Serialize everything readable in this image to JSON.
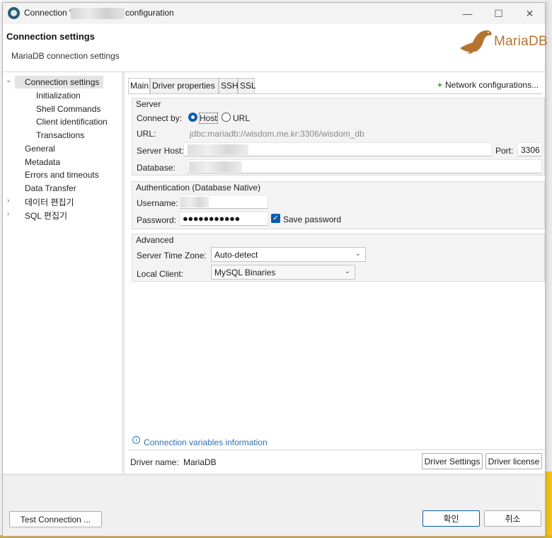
{
  "window": {
    "title_prefix": "Connection \"",
    "title_suffix": "configuration"
  },
  "header": {
    "title": "Connection settings",
    "subtitle": "MariaDB connection settings",
    "logo_text": "MariaDB"
  },
  "nav": {
    "items": [
      {
        "label": "Connection settings"
      },
      {
        "label": "Initialization"
      },
      {
        "label": "Shell Commands"
      },
      {
        "label": "Client identification"
      },
      {
        "label": "Transactions"
      },
      {
        "label": "General"
      },
      {
        "label": "Metadata"
      },
      {
        "label": "Errors and timeouts"
      },
      {
        "label": "Data Transfer"
      },
      {
        "label": "데이터 편집기"
      },
      {
        "label": "SQL 편집기"
      }
    ]
  },
  "tabs": [
    {
      "label": "Main"
    },
    {
      "label": "Driver properties"
    },
    {
      "label": "SSH"
    },
    {
      "label": "SSL"
    }
  ],
  "network_config": "Network configurations...",
  "server": {
    "group_title": "Server",
    "connect_by_label": "Connect by:",
    "option_host": "Host",
    "option_url": "URL",
    "url_label": "URL:",
    "url_value": "jdbc:mariadb://wisdom.me.kr:3306/wisdom_db",
    "host_label": "Server Host:",
    "port_label": "Port:",
    "port_value": "3306",
    "database_label": "Database:"
  },
  "auth": {
    "group_title": "Authentication (Database Native)",
    "username_label": "Username:",
    "password_label": "Password:",
    "password_mask": "●●●●●●●●●●●",
    "save_password": "Save password"
  },
  "advanced": {
    "group_title": "Advanced",
    "timezone_label": "Server Time Zone:",
    "timezone_value": "Auto-detect",
    "client_label": "Local Client:",
    "client_value": "MySQL Binaries"
  },
  "info_link": "Connection variables information",
  "driver": {
    "name_label": "Driver name:",
    "name_value": "MariaDB",
    "settings_button": "Driver Settings",
    "license_button": "Driver license"
  },
  "footer": {
    "test_button": "Test Connection ...",
    "ok_button": "확인",
    "cancel_button": "취소"
  },
  "colors": {
    "accent": "#0b5cad",
    "link": "#2f6fad",
    "logo": "#b4742f"
  }
}
